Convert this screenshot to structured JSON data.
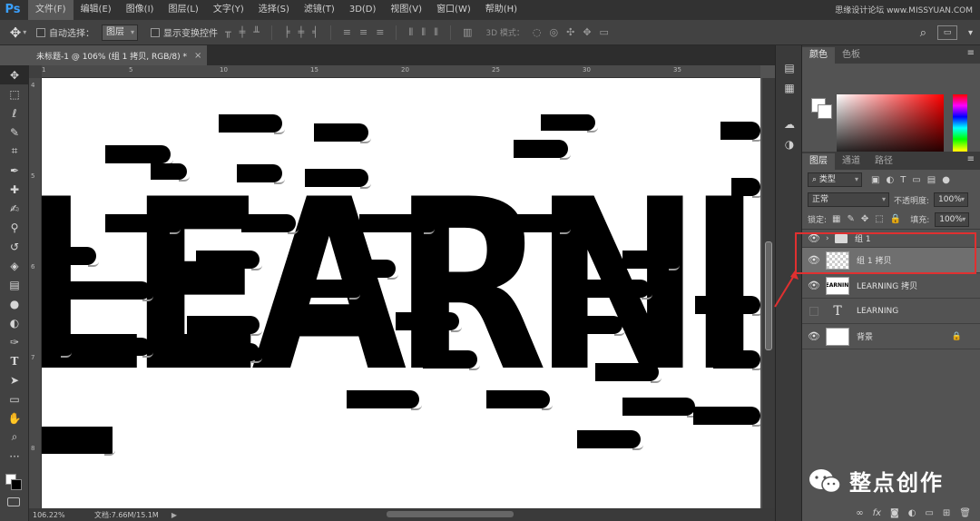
{
  "app": {
    "logo": "Ps"
  },
  "menu": [
    "文件(F)",
    "编辑(E)",
    "图像(I)",
    "图层(L)",
    "文字(Y)",
    "选择(S)",
    "滤镜(T)",
    "3D(D)",
    "视图(V)",
    "窗口(W)",
    "帮助(H)"
  ],
  "watermark_top": "思缘设计论坛 www.MISSYUAN.COM",
  "options": {
    "auto_select_label": "自动选择：",
    "auto_select_value": "图层",
    "show_transform_label": "显示变换控件",
    "mode_3d_label": "3D 模式："
  },
  "document": {
    "tab_title": "未标题-1 @ 106% (组 1 拷贝, RGB/8) *",
    "tab_close": "×",
    "ruler_top": [
      "1",
      "5",
      "10",
      "15",
      "20",
      "25",
      "30",
      "35"
    ],
    "ruler_left": [
      "4",
      "5",
      "6",
      "7",
      "8"
    ],
    "canvas_text": "LEARNING"
  },
  "status": {
    "zoom": "106.22%",
    "doc_info": "文档:7.66M/15.1M",
    "arrow": "▶"
  },
  "color_panel": {
    "tabs": [
      "颜色",
      "色板"
    ],
    "active": "颜色"
  },
  "layers_panel": {
    "tabs": [
      "图层",
      "通道",
      "路径"
    ],
    "active": "图层",
    "filter_kind": "类型",
    "blend_mode": "正常",
    "opacity_label": "不透明度:",
    "opacity_value": "100%",
    "lock_label": "锁定:",
    "fill_label": "填充:",
    "fill_value": "100%",
    "layers": [
      {
        "name": "组 1",
        "kind": "group",
        "visible": true,
        "selected": false
      },
      {
        "name": "组 1 拷贝",
        "kind": "raster",
        "visible": true,
        "selected": true
      },
      {
        "name": "LEARNING 拷贝",
        "kind": "raster",
        "visible": true,
        "selected": false,
        "thumb_text": "LEARNING"
      },
      {
        "name": "LEARNING",
        "kind": "type",
        "visible": false,
        "selected": false,
        "thumb_text": "T"
      },
      {
        "name": "背景",
        "kind": "background",
        "visible": true,
        "selected": false
      }
    ]
  },
  "brand": {
    "name": "整点创作"
  },
  "colors": {
    "highlight": "#e03030",
    "accent": "#3aa0ff"
  }
}
